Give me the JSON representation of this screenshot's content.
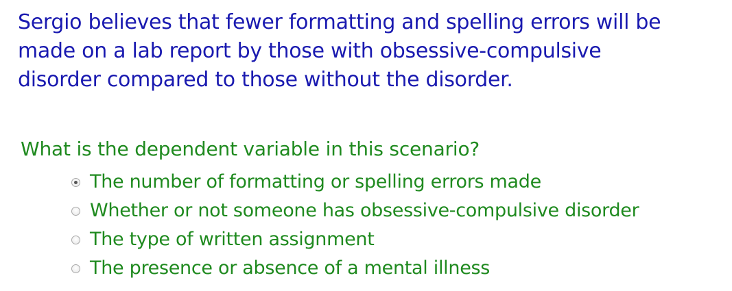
{
  "scenario": {
    "line1": "Sergio believes that fewer formatting and spelling errors will be",
    "line2": "made on a lab report by those with obsessive-compulsive",
    "line3": "disorder compared to those without the disorder."
  },
  "question": {
    "text": "What is the dependent variable in this scenario?"
  },
  "options": [
    {
      "label": "The number of formatting or spelling errors made",
      "selected": true
    },
    {
      "label": "Whether or not someone has obsessive-compulsive disorder",
      "selected": false
    },
    {
      "label": "The type of written assignment",
      "selected": false
    },
    {
      "label": "The presence or absence of a mental illness",
      "selected": false
    }
  ],
  "colors": {
    "scenario_text": "#1a1ab0",
    "question_text": "#1f8a1f"
  }
}
